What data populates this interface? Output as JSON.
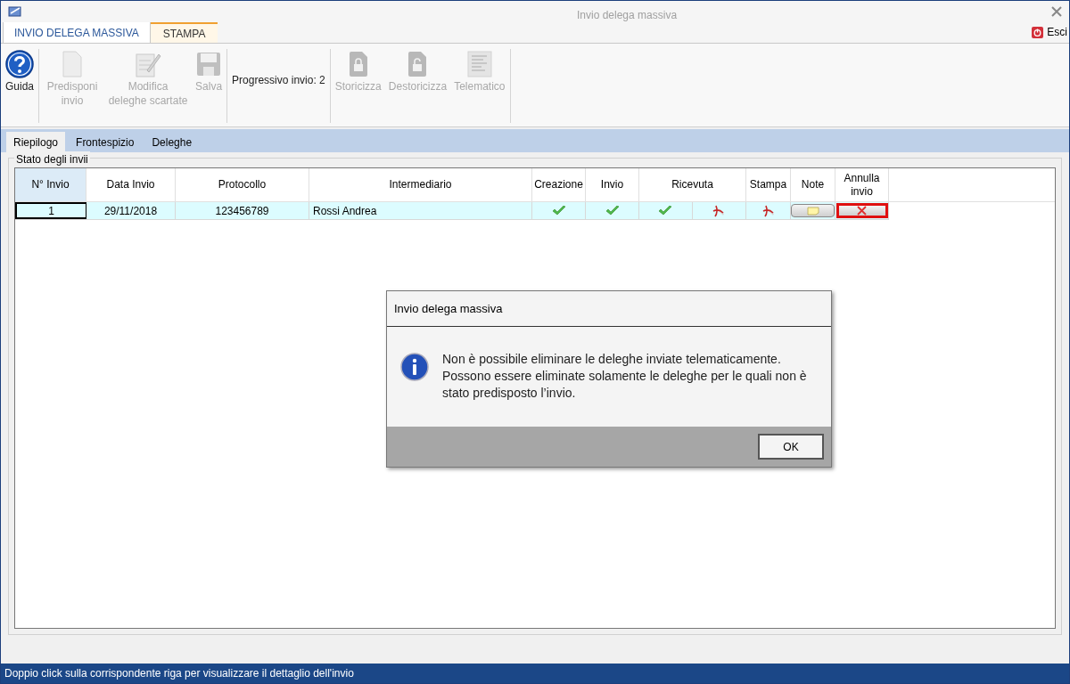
{
  "window": {
    "title": "Invio delega massiva"
  },
  "ribbon_tabs": [
    {
      "label": "INVIO DELEGA MASSIVA",
      "selected": true
    },
    {
      "label": "STAMPA",
      "selected": false
    }
  ],
  "exit_button": {
    "label": "Esci"
  },
  "toolbar_groups": [
    {
      "items": [
        {
          "kind": "help",
          "label": "Guida",
          "disabled": false
        }
      ]
    },
    {
      "items": [
        {
          "kind": "document",
          "label": "Predisponi invio",
          "disabled": true
        },
        {
          "kind": "edit",
          "label": "Modifica deleghe scartate",
          "disabled": true
        },
        {
          "kind": "save",
          "label": "Salva",
          "disabled": true
        }
      ]
    },
    {
      "items": [
        {
          "kind": "text",
          "label": "Progressivo invio: 2"
        }
      ]
    },
    {
      "items": [
        {
          "kind": "lock",
          "label": "Storicizza",
          "disabled": true
        },
        {
          "kind": "unlock",
          "label": "Destoricizza",
          "disabled": true
        },
        {
          "kind": "telematic",
          "label": "Telematico",
          "disabled": true
        }
      ]
    }
  ],
  "tabs": [
    {
      "label": "Riepilogo",
      "selected": true
    },
    {
      "label": "Frontespizio",
      "selected": false
    },
    {
      "label": "Deleghe",
      "selected": false
    }
  ],
  "group_title": "Stato degli invii",
  "table": {
    "columns": [
      {
        "label": "N° Invio",
        "selected": true
      },
      {
        "label": "Data Invio",
        "selected": false
      },
      {
        "label": "Protocollo",
        "selected": false
      },
      {
        "label": "Intermediario",
        "selected": false
      },
      {
        "label": "Creazione",
        "selected": false
      },
      {
        "label": "Invio",
        "selected": false
      },
      {
        "label": "Ricevuta",
        "selected": false
      },
      {
        "label": "Stampa",
        "selected": false
      },
      {
        "label": "Note",
        "selected": false
      },
      {
        "label": "Annulla invio",
        "selected": false
      }
    ],
    "rows": [
      {
        "selected": true,
        "cells": [
          {
            "kind": "text",
            "text": "1",
            "focused": true
          },
          {
            "kind": "text",
            "text": "29/11/2018",
            "focused": false
          },
          {
            "kind": "text",
            "text": "123456789",
            "focused": false
          },
          {
            "kind": "text",
            "text": "Rossi Andrea",
            "focused": false
          },
          {
            "kind": "check",
            "focused": false
          },
          {
            "kind": "check",
            "focused": false
          },
          {
            "kind": "pair",
            "focused": false
          },
          {
            "kind": "pdf",
            "focused": false
          },
          {
            "kind": "note",
            "focused": false
          },
          {
            "kind": "cancel",
            "focused": false,
            "highlighted": true
          }
        ]
      }
    ]
  },
  "dialog": {
    "title": "Invio delega massiva",
    "message": "Non è possibile eliminare le deleghe inviate telematicamente. Possono essere eliminate solamente le deleghe per le quali non è stato predisposto l’invio.",
    "button": "OK"
  },
  "status_bar": "Doppio click sulla corrispondente riga per visualizzare il dettaglio dell'invio"
}
